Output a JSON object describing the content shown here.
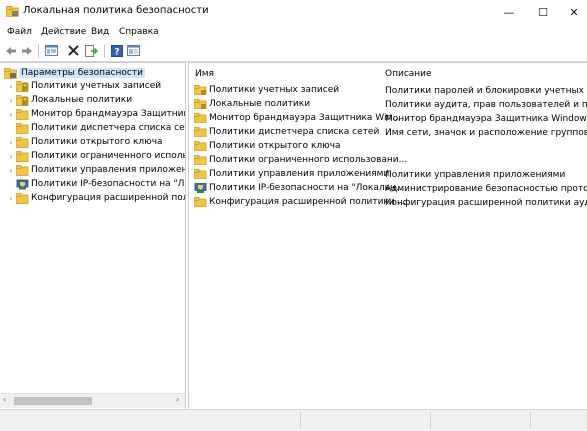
{
  "window": {
    "title": "Локальная политика безопасности",
    "controls": {
      "minimize": "—",
      "maximize": "☐",
      "close": "✕"
    }
  },
  "menu": [
    "Файл",
    "Действие",
    "Вид",
    "Справка"
  ],
  "toolbar": [
    "back-arrow-icon",
    "forward-arrow-icon",
    "show-hide-tree-icon",
    "delete-icon",
    "export-list-icon",
    "help-icon",
    "properties-icon"
  ],
  "tree": {
    "root": "Параметры безопасности",
    "items": [
      {
        "label": "Политики учетных записей",
        "icon": "lock-folder"
      },
      {
        "label": "Локальные политики",
        "icon": "lock-folder"
      },
      {
        "label": "Монитор брандмауэра Защитника Windows",
        "icon": "folder"
      },
      {
        "label": "Политики диспетчера списка сетей",
        "icon": "folder"
      },
      {
        "label": "Политики открытого ключа",
        "icon": "folder"
      },
      {
        "label": "Политики ограниченного использования программ",
        "icon": "folder"
      },
      {
        "label": "Политики управления приложениями",
        "icon": "folder"
      },
      {
        "label": "Политики IP-безопасности на \"Локальный компьютер\"",
        "icon": "shield"
      },
      {
        "label": "Конфигурация расширенной политики аудита",
        "icon": "folder"
      }
    ]
  },
  "list": {
    "headers": {
      "name": "Имя",
      "description": "Описание"
    },
    "rows": [
      {
        "name": "Политики учетных записей",
        "description": "Политики паролей и блокировки учетных запи",
        "icon": "lock-folder"
      },
      {
        "name": "Локальные политики",
        "description": "Политики аудита, прав пользователей и пара...",
        "icon": "lock-folder"
      },
      {
        "name": "Монитор брандмауэра Защитника Win...",
        "description": "Монитор брандмауэра Защитника Windows в...",
        "icon": "folder"
      },
      {
        "name": "Политики диспетчера списка сетей",
        "description": "Имя сети, значок и расположение групповых ...",
        "icon": "folder"
      },
      {
        "name": "Политики открытого ключа",
        "description": "",
        "icon": "folder"
      },
      {
        "name": "Политики ограниченного использовани...",
        "description": "",
        "icon": "folder"
      },
      {
        "name": "Политики управления приложениями",
        "description": "Политики управления приложениями",
        "icon": "folder"
      },
      {
        "name": "Политики IP-безопасности на \"Локальн...",
        "description": "Администрирование безопасностью протоко...",
        "icon": "shield"
      },
      {
        "name": "Конфигурация расширенной политики ...",
        "description": "Конфигурация расширенной политики аудита",
        "icon": "folder"
      }
    ]
  },
  "colors": {
    "selection": "#cce8ff",
    "folder": "#f5c542",
    "folder_dark": "#dca820",
    "accent": "#0a64ad"
  }
}
